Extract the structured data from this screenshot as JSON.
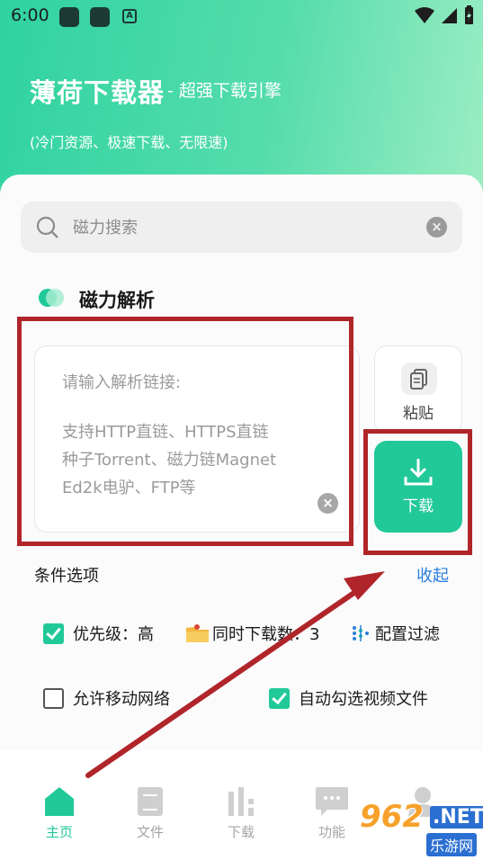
{
  "status_bar": {
    "time": "6:00",
    "app_icon_letter": "A"
  },
  "header": {
    "title": "薄荷下载器",
    "subtitle": "- 超强下载引擎",
    "description": "(冷门资源、极速下载、无限速)"
  },
  "search": {
    "placeholder": "磁力搜索",
    "value": ""
  },
  "magnet_section": {
    "title": "磁力解析"
  },
  "link_input": {
    "prompt": "请输入解析链接:",
    "support_lines": [
      "支持HTTP直链、HTTPS直链",
      "种子Torrent、磁力链Magnet",
      "Ed2k电驴、FTP等"
    ]
  },
  "buttons": {
    "paste": "粘贴",
    "download": "下载"
  },
  "options": {
    "title": "条件选项",
    "collapse": "收起",
    "priority": {
      "label": "优先级：高",
      "checked": true
    },
    "concurrent": {
      "label": "同时下载数：3"
    },
    "filter": {
      "label": "配置过滤"
    },
    "mobile_network": {
      "label": "允许移动网络",
      "checked": false
    },
    "auto_select_video": {
      "label": "自动勾选视频文件",
      "checked": true
    }
  },
  "nav": [
    {
      "label": "主页",
      "icon": "home-icon",
      "active": true
    },
    {
      "label": "文件",
      "icon": "file-icon",
      "active": false
    },
    {
      "label": "下载",
      "icon": "download-stats-icon",
      "active": false
    },
    {
      "label": "功能",
      "icon": "chat-icon",
      "active": false
    },
    {
      "label": "",
      "icon": "user-icon",
      "active": false
    }
  ],
  "watermark": {
    "number": "962",
    "net": ".NET",
    "site": "乐游网"
  },
  "colors": {
    "accent": "#21c998",
    "link": "#2b7fdb",
    "annotation": "#b0252a"
  }
}
